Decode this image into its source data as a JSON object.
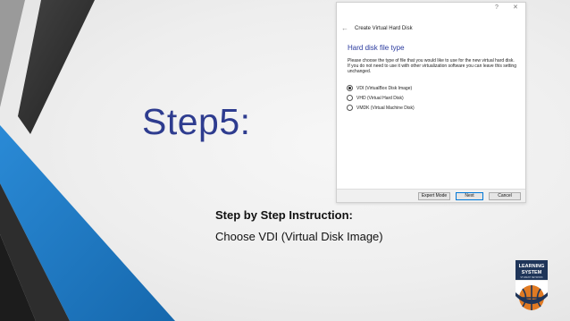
{
  "slide": {
    "title": "Step5:",
    "subheading": "Step by Step Instruction:",
    "body": "Choose VDI (Virtual Disk Image)"
  },
  "dialog": {
    "window_help": "?",
    "window_close": "✕",
    "back": "←",
    "title": "Create Virtual Hard Disk",
    "heading": "Hard disk file type",
    "description": "Please choose the type of file that you would like to use for the new virtual hard disk. If you do not need to use it with other virtualization software you can leave this setting unchanged.",
    "options": [
      {
        "label": "VDI (VirtualBox Disk Image)",
        "selected": true
      },
      {
        "label": "VHD (Virtual Hard Disk)",
        "selected": false
      },
      {
        "label": "VMDK (Virtual Machine Disk)",
        "selected": false
      }
    ],
    "buttons": {
      "expert": "Expert Mode",
      "next": "Next",
      "cancel": "Cancel"
    }
  },
  "logo": {
    "line1": "LEARNING",
    "line2": "SYSTEM",
    "tagline": "STUDENT NETWORK"
  },
  "colors": {
    "title": "#2e3c8f",
    "accent_blue": "#1f7fc9",
    "dark_gray": "#3a3a3a",
    "logo_navy": "#1f3559",
    "logo_orange": "#e07a23"
  }
}
